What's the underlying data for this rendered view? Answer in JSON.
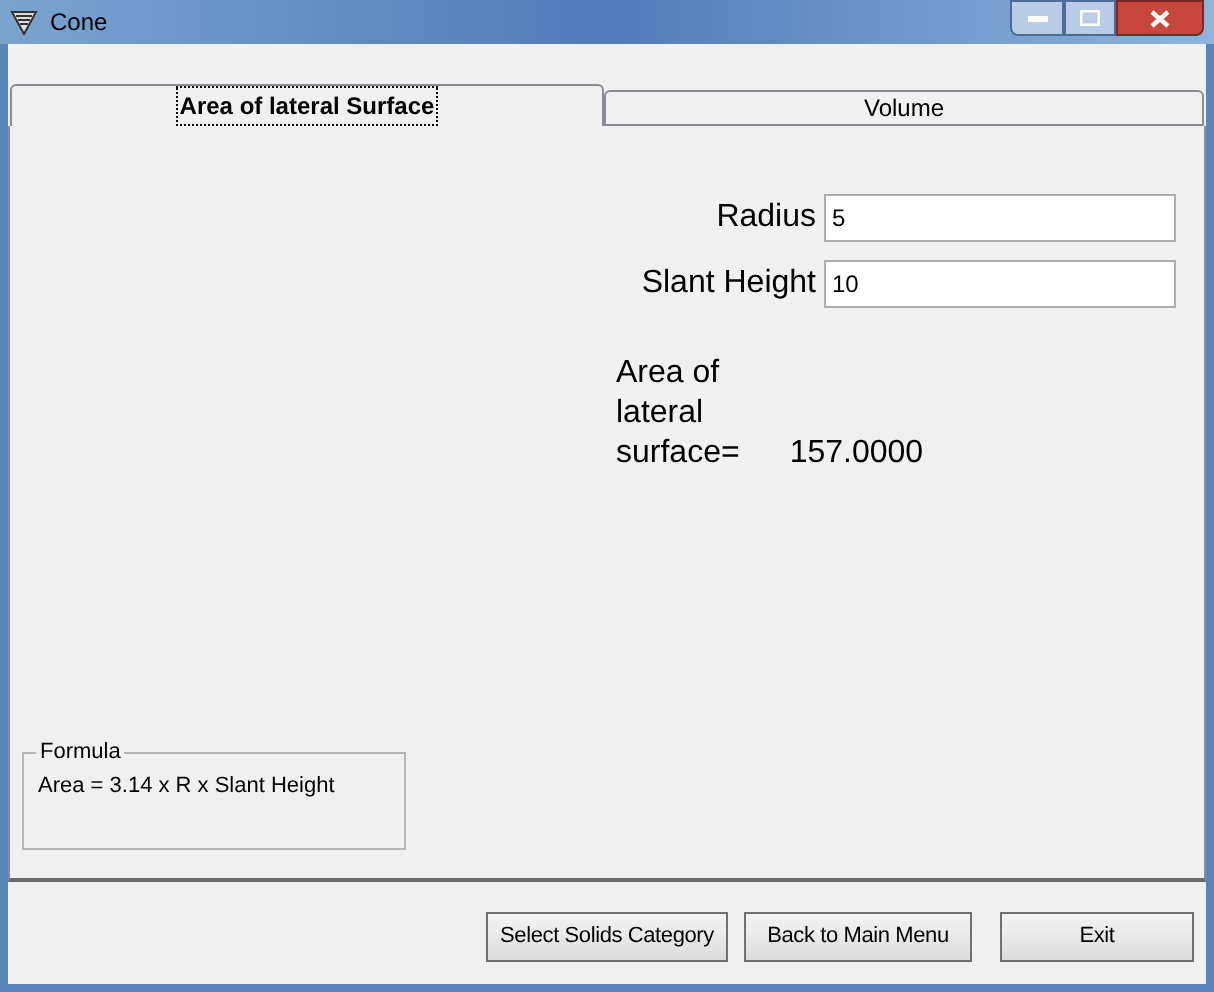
{
  "window": {
    "title": "Cone"
  },
  "tabs": [
    {
      "label": "Area of lateral Surface",
      "selected": true
    },
    {
      "label": "Volume",
      "selected": false
    }
  ],
  "fields": [
    {
      "label": "Radius",
      "value": "5"
    },
    {
      "label": "Slant Height",
      "value": "10"
    }
  ],
  "result": {
    "label_lines": [
      "Area of",
      "lateral",
      "surface="
    ],
    "value": "157.0000"
  },
  "formula": {
    "title": "Formula",
    "text": "Area = 3.14 x R x Slant Height"
  },
  "buttons": [
    "Select Solids Category",
    "Back to Main Menu",
    "Exit"
  ]
}
